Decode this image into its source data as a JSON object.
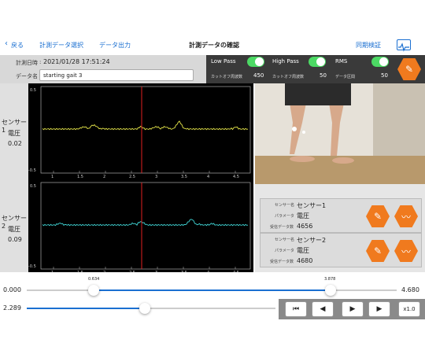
{
  "nav": {
    "back": "戻る",
    "select": "計測データ選択",
    "export": "データ出力",
    "title": "計測データの確認",
    "sync": "同期検証"
  },
  "info": {
    "datetime_label": "計測日時",
    "datetime": "2021/01/28 17:51:24",
    "name_label": "データ名",
    "name_value": "starting gait 3"
  },
  "filters": {
    "low": "Low Pass",
    "high": "High Pass",
    "rms": "RMS",
    "cutoff_low_label": "カットオフ周波数",
    "cutoff_low": "450",
    "cutoff_high_label": "カットオフ周波数",
    "cutoff_high": "50",
    "interval_label": "データ区間",
    "interval": "50"
  },
  "sensors": [
    {
      "side_name": "センサー1",
      "side_param": "電圧",
      "side_value": "0.02",
      "card_name_label": "センサー名",
      "card_name": "センサー1",
      "card_param_label": "パラメータ",
      "card_param": "電圧",
      "card_count_label": "受信データ数",
      "card_count": "4656"
    },
    {
      "side_name": "センサー2",
      "side_param": "電圧",
      "side_value": "0.09",
      "card_name_label": "センサー名",
      "card_name": "センサー2",
      "card_param_label": "パラメータ",
      "card_param": "電圧",
      "card_count_label": "受信データ数",
      "card_count": "4680"
    }
  ],
  "plot1": {
    "ymax": "0.5",
    "ymin": "-0.5",
    "xticks": [
      "1",
      "1.5",
      "2",
      "2.5",
      "3",
      "3.5",
      "4",
      "4.5"
    ]
  },
  "plot2": {
    "ymax": "0.5",
    "ymin": "-0.5",
    "xticks": [
      "1",
      "1.5",
      "2",
      "2.5",
      "3",
      "3.5",
      "4",
      "4.5"
    ]
  },
  "range": {
    "start": "0.000",
    "end": "4.680",
    "lo": "0.634",
    "hi": "3.878",
    "current": "2.289"
  },
  "playback": {
    "speed": "x1.0"
  },
  "colors": {
    "trace1": "#e8e84a",
    "trace2": "#40d8d8",
    "cursor": "#e02020",
    "accent": "#f07a1e",
    "toggle": "#4cd964"
  }
}
